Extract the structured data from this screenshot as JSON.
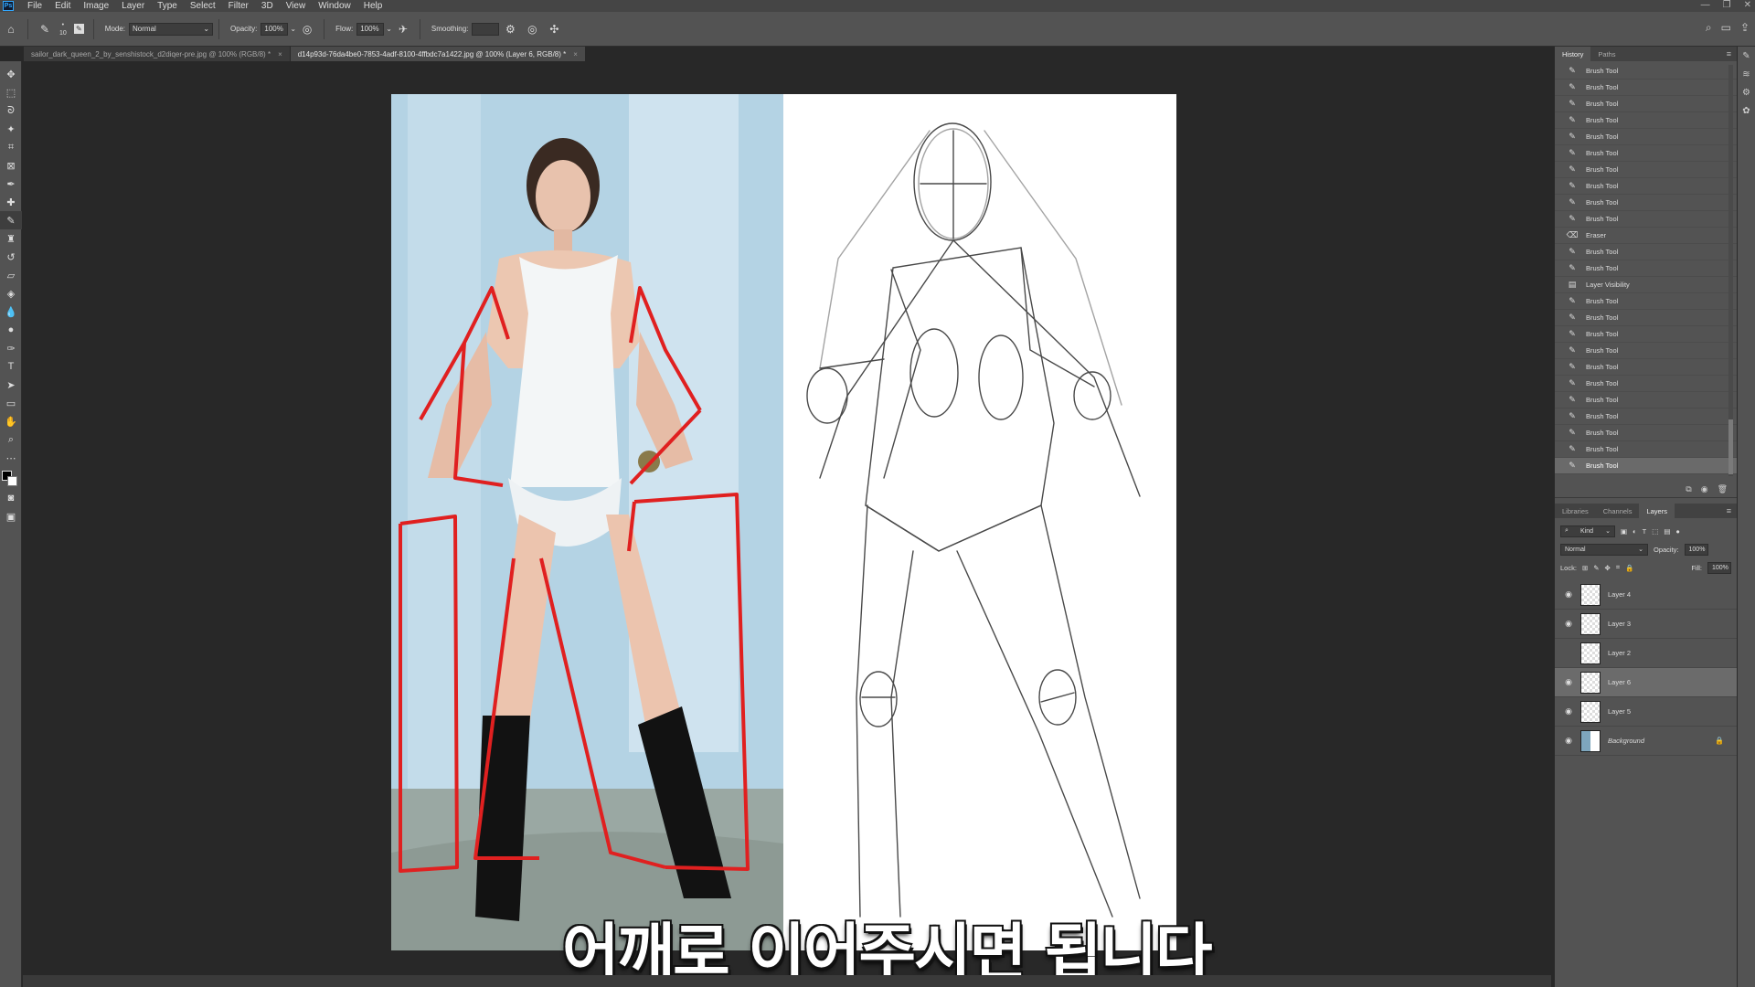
{
  "app": {
    "logo": "Ps",
    "menus": [
      "File",
      "Edit",
      "Image",
      "Layer",
      "Type",
      "Select",
      "Filter",
      "3D",
      "View",
      "Window",
      "Help"
    ],
    "window_controls": [
      "—",
      "❐",
      "✕"
    ]
  },
  "options": {
    "brush_size": "10",
    "mode_label": "Mode:",
    "mode_value": "Normal",
    "opacity_label": "Opacity:",
    "opacity_value": "100%",
    "flow_label": "Flow:",
    "flow_value": "100%",
    "smoothing_label": "Smoothing:",
    "smoothing_value": ""
  },
  "tabs": [
    {
      "label": "sailor_dark_queen_2_by_senshistock_d2diqer-pre.jpg @ 100% (RGB/8) *",
      "active": false
    },
    {
      "label": "d14p93d-76da4be0-7853-4adf-8100-4ffbdc7a1422.jpg @ 100% (Layer 6, RGB/8) *",
      "active": true
    }
  ],
  "caption": "어깨로 이어주시면 됩니다",
  "history": {
    "tabs": [
      "History",
      "Paths"
    ],
    "items": [
      {
        "icon": "brush-icon",
        "label": "Brush Tool"
      },
      {
        "icon": "brush-icon",
        "label": "Brush Tool"
      },
      {
        "icon": "brush-icon",
        "label": "Brush Tool"
      },
      {
        "icon": "brush-icon",
        "label": "Brush Tool"
      },
      {
        "icon": "brush-icon",
        "label": "Brush Tool"
      },
      {
        "icon": "brush-icon",
        "label": "Brush Tool"
      },
      {
        "icon": "brush-icon",
        "label": "Brush Tool"
      },
      {
        "icon": "brush-icon",
        "label": "Brush Tool"
      },
      {
        "icon": "brush-icon",
        "label": "Brush Tool"
      },
      {
        "icon": "brush-icon",
        "label": "Brush Tool"
      },
      {
        "icon": "eraser-icon",
        "label": "Eraser"
      },
      {
        "icon": "brush-icon",
        "label": "Brush Tool"
      },
      {
        "icon": "brush-icon",
        "label": "Brush Tool"
      },
      {
        "icon": "layer-visibility-icon",
        "label": "Layer Visibility"
      },
      {
        "icon": "brush-icon",
        "label": "Brush Tool"
      },
      {
        "icon": "brush-icon",
        "label": "Brush Tool"
      },
      {
        "icon": "brush-icon",
        "label": "Brush Tool"
      },
      {
        "icon": "brush-icon",
        "label": "Brush Tool"
      },
      {
        "icon": "brush-icon",
        "label": "Brush Tool"
      },
      {
        "icon": "brush-icon",
        "label": "Brush Tool"
      },
      {
        "icon": "brush-icon",
        "label": "Brush Tool"
      },
      {
        "icon": "brush-icon",
        "label": "Brush Tool"
      },
      {
        "icon": "brush-icon",
        "label": "Brush Tool"
      },
      {
        "icon": "brush-icon",
        "label": "Brush Tool"
      },
      {
        "icon": "brush-icon",
        "label": "Brush Tool"
      }
    ]
  },
  "layers": {
    "tabs": [
      "Libraries",
      "Channels",
      "Layers"
    ],
    "filter_kind": "Kind",
    "blend_mode": "Normal",
    "opacity_label": "Opacity:",
    "opacity_value": "100%",
    "lock_label": "Lock:",
    "fill_label": "Fill:",
    "fill_value": "100%",
    "items": [
      {
        "name": "Layer 4",
        "visible": true,
        "selected": false,
        "background": false
      },
      {
        "name": "Layer 3",
        "visible": true,
        "selected": false,
        "background": false
      },
      {
        "name": "Layer 2",
        "visible": false,
        "selected": false,
        "background": false
      },
      {
        "name": "Layer 6",
        "visible": true,
        "selected": true,
        "background": false
      },
      {
        "name": "Layer 5",
        "visible": true,
        "selected": false,
        "background": false
      },
      {
        "name": "Background",
        "visible": true,
        "selected": false,
        "background": true
      }
    ]
  },
  "colors": {
    "accent_red": "#e02020",
    "ui_panel": "#535353",
    "ui_bg": "#282828"
  }
}
